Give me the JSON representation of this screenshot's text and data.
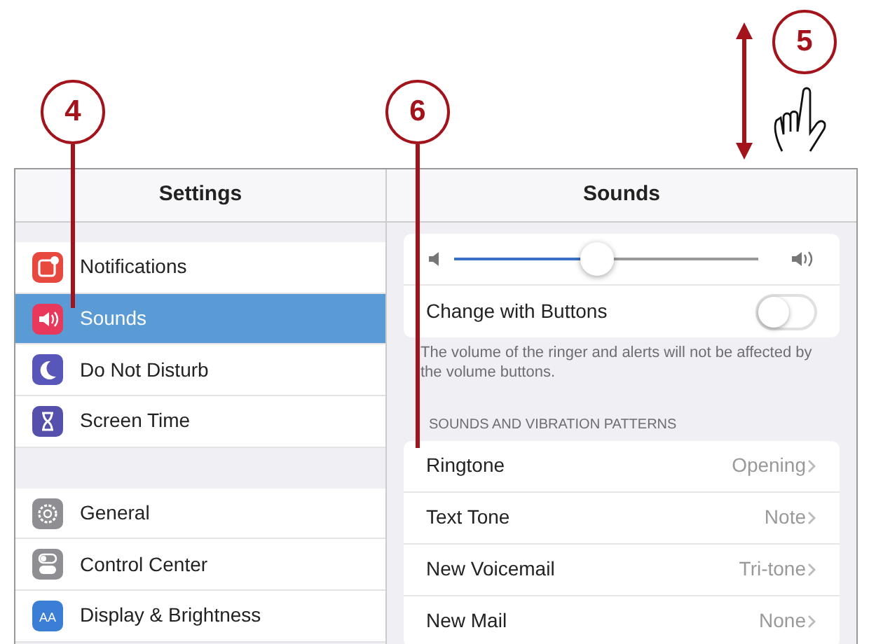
{
  "callouts": [
    {
      "label": "4"
    },
    {
      "label": "5"
    },
    {
      "label": "6"
    }
  ],
  "sidebar": {
    "title": "Settings",
    "groups": [
      [
        {
          "label": "Notifications",
          "kind": "notifications",
          "color": "#e8493f",
          "selected": false
        },
        {
          "label": "Sounds",
          "kind": "sounds",
          "color": "#e8385c",
          "selected": true
        },
        {
          "label": "Do Not Disturb",
          "kind": "moon",
          "color": "#5856b8",
          "selected": false
        },
        {
          "label": "Screen Time",
          "kind": "hourglass",
          "color": "#5650ad",
          "selected": false
        }
      ],
      [
        {
          "label": "General",
          "kind": "gear",
          "color": "#8e8e93",
          "selected": false
        },
        {
          "label": "Control Center",
          "kind": "switches",
          "color": "#8e8e93",
          "selected": false
        },
        {
          "label": "Display & Brightness",
          "kind": "text",
          "icon_text": "AA",
          "color": "#3b7ed6",
          "selected": false
        }
      ]
    ]
  },
  "detail": {
    "title": "Sounds",
    "ringer": {
      "level": 0.47
    },
    "change_with_buttons": {
      "label": "Change with Buttons",
      "on": false
    },
    "footer": "The volume of the ringer and alerts will not be affected by the volume buttons.",
    "section": "SOUNDS AND VIBRATION PATTERNS",
    "rows": [
      {
        "label": "Ringtone",
        "value": "Opening"
      },
      {
        "label": "Text Tone",
        "value": "Note"
      },
      {
        "label": "New Voicemail",
        "value": "Tri-tone"
      },
      {
        "label": "New Mail",
        "value": "None"
      }
    ]
  }
}
